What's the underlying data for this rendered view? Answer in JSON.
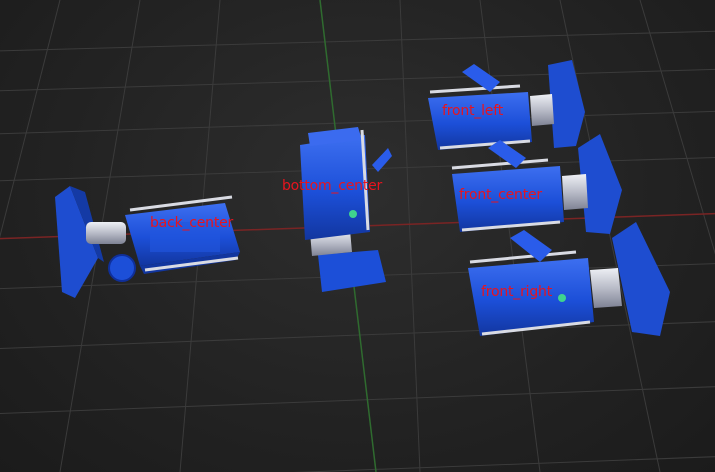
{
  "labels": {
    "front_left": "front_left",
    "bottom_center": "bottom_center",
    "front_center": "front_center",
    "back_center": "back_center",
    "front_right": "front_right"
  },
  "colors": {
    "background": "#242424",
    "grid": "#3b3b3b",
    "x_axis": "#7a2424",
    "y_axis": "#2f6b2f",
    "camera_body": "#1c4fd8",
    "camera_dark": "#0f2f9a",
    "mount_metal": "#c9ccd6",
    "label_text": "#e8141e"
  }
}
